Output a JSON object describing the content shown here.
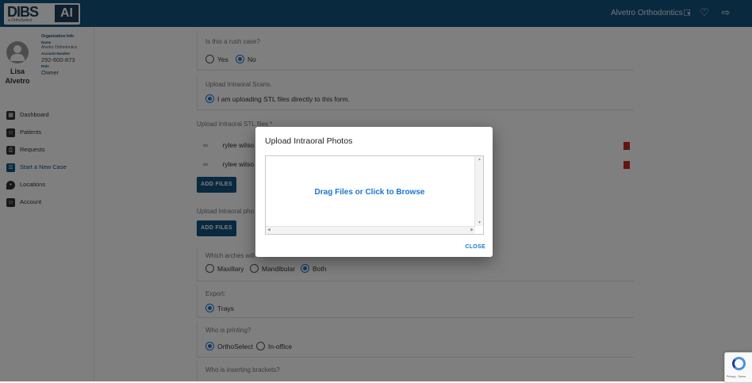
{
  "header": {
    "logo_text": "DIBS",
    "logo_ai": "AI",
    "logo_sub": "a OrthoSelect",
    "org_menu": "Alvetro Orthodontics",
    "org_menu_icon": "caret-down-icon",
    "icons": [
      "monitor-icon",
      "bell-icon",
      "logout-icon"
    ]
  },
  "user": {
    "first_name": "Lisa",
    "last_name": "Alvetro",
    "org_info_title": "Organization Info",
    "name_label": "Name",
    "name_value": "Alvetro Orthodontics",
    "account_label": "Account Number",
    "account_value": "292-600-873",
    "role_label": "Role",
    "role_value": "Owner"
  },
  "nav": [
    {
      "label": "Dashboard",
      "icon": "dashboard-icon",
      "active": false
    },
    {
      "label": "Patients",
      "icon": "patients-icon",
      "active": false
    },
    {
      "label": "Requests",
      "icon": "requests-icon",
      "active": false
    },
    {
      "label": "Start a New Case",
      "icon": "new-case-icon",
      "active": true
    },
    {
      "label": "Locations",
      "icon": "location-pin-icon",
      "active": false
    },
    {
      "label": "Account",
      "icon": "account-icon",
      "active": false
    }
  ],
  "form": {
    "rush": {
      "label": "Is this a rush case?",
      "options": [
        "Yes",
        "No"
      ],
      "selected": "No"
    },
    "scans": {
      "label": "Upload Intraoral Scans.",
      "option": "I am uploading STL files directly to this form."
    },
    "stl": {
      "label": "Upload Intraoral STL files *",
      "files": [
        "rylee wilso",
        "rylee wilso"
      ],
      "add_button": "ADD FILES"
    },
    "photos": {
      "label": "Upload intraoral pho",
      "add_button": "ADD FILES"
    },
    "arches": {
      "label": "Which arches will",
      "options": [
        "Maxillary",
        "Mandibular",
        "Both"
      ],
      "selected": "Both"
    },
    "export": {
      "label": "Export:",
      "options": [
        "Trays"
      ],
      "selected": "Trays"
    },
    "printing": {
      "label": "Who is printing?",
      "options": [
        "OrthoSelect",
        "In-office"
      ],
      "selected": "OrthoSelect"
    },
    "inserting": {
      "label": "Who is inserting brackets?"
    }
  },
  "dialog": {
    "title": "Upload Intraoral Photos",
    "dropzone_text": "Drag Files or Click to Browse",
    "close_label": "CLOSE"
  },
  "recaptcha": {
    "text": "Privacy - Terms"
  },
  "colors": {
    "primary": "#12527f",
    "accent": "#1976d2",
    "danger": "#c62828"
  }
}
